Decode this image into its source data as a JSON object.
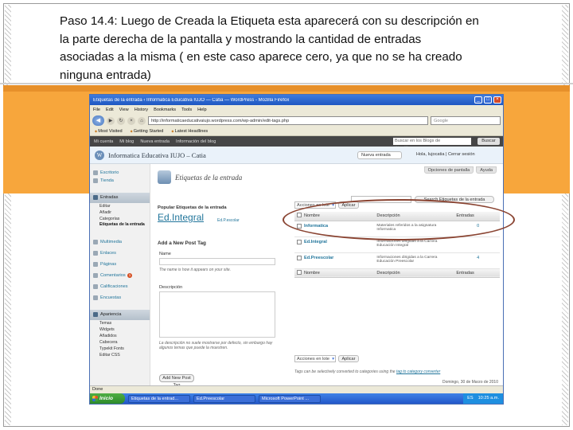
{
  "caption": {
    "line1": "Paso 14.4:  Luego de Creada la Etiqueta esta aparecerá con su descripción  en",
    "line2": "la parte derecha de la pantalla y mostrando la cantidad de entradas",
    "line3": "asociadas a la misma ( en este caso aparece cero, ya que no se ha creado",
    "line4": "ninguna entrada)"
  },
  "browser": {
    "title": "Etiquetas de la entrada ‹ Informatica Educativa IUJO — Catia — WordPress - Mozilla Firefox",
    "menu": [
      "File",
      "Edit",
      "View",
      "History",
      "Bookmarks",
      "Tools",
      "Help"
    ],
    "url": "http://informaticaeducativaiujo.wordpress.com/wp-admin/edit-tags.php",
    "search_placeholder": "Google",
    "bookmarks": [
      "Most Visited",
      "Getting Started",
      "Latest Headlines"
    ]
  },
  "wp": {
    "adminbar": [
      "Mi cuenta",
      "Mi blog",
      "Nueva entrada",
      "Información del blog"
    ],
    "adminbar_search": "Buscar en los Blogs de WordPress.com",
    "adminbar_button": "Buscar",
    "site_title": "Informatica Educativa IUJO – Catia",
    "favorites": "Nueva entrada",
    "user_area": "Hola, Iujocatia | Cerrar sesión",
    "screen_options": "Opciones de pantalla",
    "help": "Ayuda",
    "sidebar": {
      "escritorio": "Escritorio",
      "tienda": "Tienda",
      "entradas": "Entradas",
      "entradas_sub": [
        "Editar",
        "Añadir",
        "Categorías"
      ],
      "entradas_active": "Etiquetas de la entrada",
      "items": [
        "Multimedia",
        "Enlaces",
        "Páginas",
        "Comentarios",
        "Calificaciones",
        "Encuestas"
      ],
      "comments_badge": "1",
      "apariencia": "Apariencia",
      "apariencia_sub": [
        "Temas",
        "Widgets",
        "Añadidos",
        "Cabecera",
        "Typekit Fonts",
        "Editar CSS"
      ]
    },
    "page_title": "Etiquetas de la entrada",
    "search_button": "Search Etiquetas de la entrada",
    "popular_title": "Popular Etiquetas de la entrada",
    "tag_cloud": [
      "Ed.Integral",
      "Ed.P.escolar"
    ],
    "add_title": "Add a New Post Tag",
    "name_label": "Name",
    "name_help": "The name is how it appears on your site.",
    "desc_label": "Descripción",
    "desc_help": "La descripción no suele mostrarse por defecto, sin embargo hay algunos temas que puede la muestren.",
    "add_button": "Add New Post Tag",
    "bulk_action": "Acciones en lote",
    "apply": "Aplicar",
    "table": {
      "headers": [
        "Nombre",
        "Descripción",
        "Entradas"
      ],
      "rows": [
        {
          "name": "Informatica",
          "desc": "Materiales referidos a la asignatura Informatica",
          "count": "0"
        },
        {
          "name": "Ed.Integral",
          "desc": "Informaciones dirigidas a la Carrera Educación Integral",
          "count": ""
        },
        {
          "name": "Ed.Preescolar",
          "desc": "Informaciones dirigidas a la Carrera Educación Preescolar",
          "count": "4"
        }
      ]
    },
    "foot_note": "Tags can be selectively converted to categories using the",
    "foot_link": "tag to category converter",
    "date_info": "Domingo, 30 de Marzo de 2010"
  },
  "status": "Done",
  "taskbar": {
    "start": "Inicio",
    "tasks": [
      "Etiquetas de la entrad...",
      "Ed.Preescolar",
      "Microsoft PowerPoint ..."
    ],
    "tray_lang": "ES",
    "clock": "10:25 a.m."
  },
  "colors": {
    "accent": "#f7a63c",
    "annotation": "#8a4432",
    "link": "#21759b"
  }
}
